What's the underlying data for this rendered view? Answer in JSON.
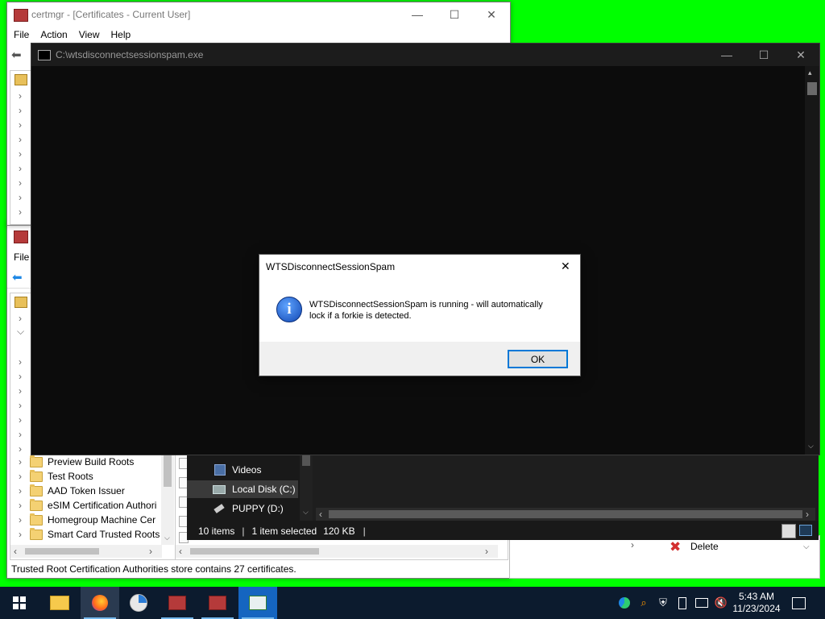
{
  "certmgr_top": {
    "title": "certmgr - [Certificates - Current User]",
    "menu": [
      "File",
      "Action",
      "View",
      "Help"
    ]
  },
  "certmgr_back": {
    "menu_file": "File",
    "tree_items": [
      "Preview Build Roots",
      "Test Roots",
      "AAD Token Issuer",
      "eSIM Certification Authori",
      "Homegroup Machine Cer",
      "Smart Card Trusted Roots"
    ],
    "status": "Trusted Root Certification Authorities store contains 27 certificates."
  },
  "actions_panel": {
    "delete_label": "Delete"
  },
  "console": {
    "title": "C:\\wtsdisconnectsessionspam.exe"
  },
  "dialog": {
    "title": "WTSDisconnectSessionSpam",
    "message_line1": "WTSDisconnectSessionSpam is running - will automatically",
    "message_line2": "lock if a forkie is detected.",
    "ok_label": "OK",
    "icon": "info-icon"
  },
  "explorer": {
    "nav_items": [
      {
        "label": "Videos",
        "icon": "videos-folder-icon"
      },
      {
        "label": "Local Disk (C:)",
        "icon": "local-disk-icon"
      },
      {
        "label": "PUPPY (D:)",
        "icon": "usb-drive-icon"
      }
    ],
    "status_items": "10 items",
    "status_selected": "1 item selected",
    "status_size": "120 KB"
  },
  "taskbar": {
    "time": "5:43 AM",
    "date": "11/23/2024",
    "apps": [
      "file-explorer-icon",
      "firefox-icon",
      "clock-app-icon",
      "certmgr-icon",
      "certmgr-icon",
      "console-app-icon"
    ],
    "tray_icons": [
      "edge-icon",
      "search-icon",
      "shield-icon",
      "usb-eject-icon",
      "network-icon",
      "volume-muted-icon"
    ]
  },
  "colors": {
    "desktop": "#00ff00",
    "taskbar": "#0c1b2e",
    "accent": "#0078d7"
  }
}
